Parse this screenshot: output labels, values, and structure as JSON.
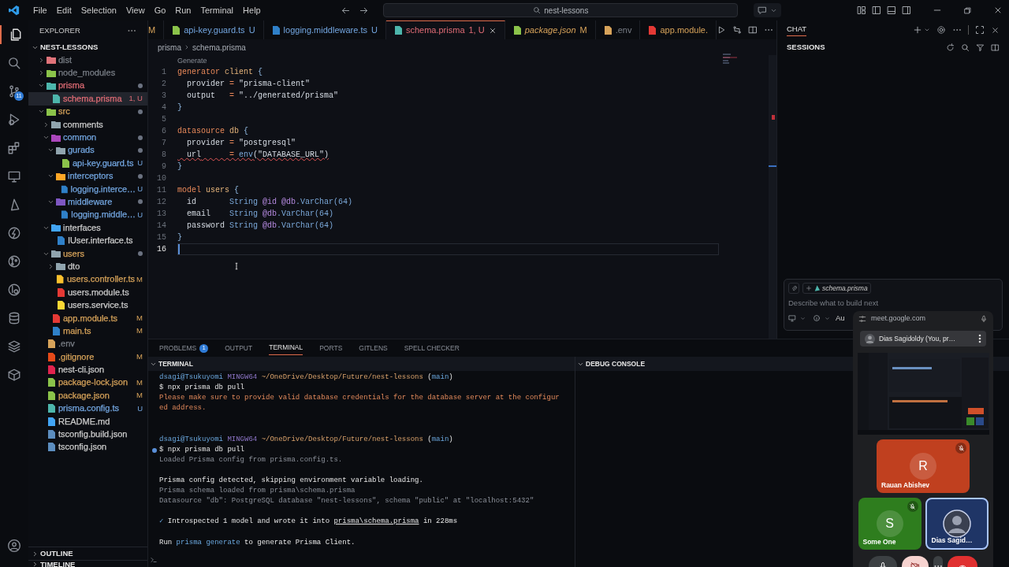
{
  "menu": [
    "File",
    "Edit",
    "Selection",
    "View",
    "Go",
    "Run",
    "Terminal",
    "Help"
  ],
  "search": "nest-lessons",
  "activity_bar": [
    {
      "kind": "files",
      "selected": true
    },
    {
      "kind": "search",
      "selected": false
    },
    {
      "kind": "branch",
      "selected": false,
      "badge": "11"
    },
    {
      "kind": "debug",
      "selected": false
    },
    {
      "kind": "blocks",
      "selected": false
    },
    {
      "kind": "monitor",
      "selected": false
    },
    {
      "kind": "triangle",
      "selected": false
    },
    {
      "kind": "bolt",
      "selected": false
    },
    {
      "kind": "commit",
      "selected": false
    },
    {
      "kind": "inspect",
      "selected": false
    },
    {
      "kind": "database",
      "selected": false
    },
    {
      "kind": "layers",
      "selected": false
    },
    {
      "kind": "box",
      "selected": false
    }
  ],
  "explorer": {
    "title": "EXPLORER",
    "project": "NEST-LESSONS",
    "tree": [
      {
        "name": "dist",
        "kind": "folder",
        "expanded": false,
        "color": "#7a7f87",
        "icon": {
          "color": "#e0737a"
        }
      },
      {
        "name": "node_modules",
        "kind": "folder",
        "expanded": false,
        "color": "#7a7f87",
        "icon": {
          "color": "#8bc34a"
        }
      },
      {
        "name": "prisma",
        "kind": "folder",
        "expanded": true,
        "color": "#e06c75",
        "icon": {
          "color": "#4db6ac"
        },
        "dot": true,
        "children": [
          {
            "name": "schema.prisma",
            "kind": "file",
            "color": "#e06c75",
            "icon": {
              "color": "#4db6ac"
            },
            "badge": "1, U",
            "selected": true
          }
        ]
      },
      {
        "name": "src",
        "kind": "folder",
        "expanded": true,
        "color": "#d7a35a",
        "icon": {
          "color": "#8bc34a"
        },
        "dot": true,
        "children": [
          {
            "name": "comments",
            "kind": "folder",
            "expanded": false,
            "icon": {
              "color": "#90a4ae"
            }
          },
          {
            "name": "common",
            "kind": "folder",
            "expanded": true,
            "color": "#73a6e0",
            "icon": {
              "color": "#ab47bc"
            },
            "dot": true,
            "children": [
              {
                "name": "gurads",
                "kind": "folder",
                "expanded": true,
                "color": "#73a6e0",
                "icon": {
                  "color": "#90a4ae"
                },
                "dot": true,
                "children": [
                  {
                    "name": "api-key.guard.ts",
                    "kind": "file",
                    "color": "#73a6e0",
                    "icon": {
                      "color": "#8bc34a"
                    },
                    "badge": "U",
                    "selected": false
                  }
                ]
              },
              {
                "name": "interceptors",
                "kind": "folder",
                "expanded": true,
                "color": "#73a6e0",
                "icon": {
                  "color": "#ffa726"
                },
                "dot": true,
                "children": [
                  {
                    "name": "logging.interce…",
                    "kind": "file",
                    "color": "#73a6e0",
                    "icon": {
                      "color": "#2f80c8"
                    },
                    "badge": "U",
                    "selected": false
                  }
                ]
              },
              {
                "name": "middleware",
                "kind": "folder",
                "expanded": true,
                "color": "#73a6e0",
                "icon": {
                  "color": "#7e57c2"
                },
                "dot": true,
                "children": [
                  {
                    "name": "logging.middle…",
                    "kind": "file",
                    "color": "#73a6e0",
                    "icon": {
                      "color": "#2f80c8"
                    },
                    "badge": "U",
                    "selected": false
                  }
                ]
              }
            ]
          },
          {
            "name": "interfaces",
            "kind": "folder",
            "expanded": true,
            "icon": {
              "color": "#42a5f5"
            },
            "children": [
              {
                "name": "IUser.interface.ts",
                "kind": "file",
                "icon": {
                  "color": "#2f80c8"
                },
                "selected": false
              }
            ]
          },
          {
            "name": "users",
            "kind": "folder",
            "expanded": true,
            "color": "#d7a35a",
            "icon": {
              "color": "#90a4ae"
            },
            "dot": true,
            "children": [
              {
                "name": "dto",
                "kind": "folder",
                "expanded": false,
                "icon": {
                  "color": "#90a4ae"
                }
              },
              {
                "name": "users.controller.ts",
                "kind": "file",
                "color": "#d7a35a",
                "icon": {
                  "color": "#fbc02d"
                },
                "badge": "M",
                "selected": false
              },
              {
                "name": "users.module.ts",
                "kind": "file",
                "icon": {
                  "color": "#e53935"
                },
                "selected": false
              },
              {
                "name": "users.service.ts",
                "kind": "file",
                "icon": {
                  "color": "#fdd835"
                },
                "selected": false
              }
            ]
          },
          {
            "name": "app.module.ts",
            "kind": "file",
            "color": "#d7a35a",
            "icon": {
              "color": "#e53935"
            },
            "badge": "M",
            "selected": false
          },
          {
            "name": "main.ts",
            "kind": "file",
            "color": "#d7a35a",
            "icon": {
              "color": "#2f80c8"
            },
            "badge": "M",
            "selected": false
          }
        ]
      },
      {
        "name": ".env",
        "kind": "file",
        "color": "#7a7f87",
        "icon": {
          "color": "#d7a35a"
        },
        "selected": false
      },
      {
        "name": ".gitignore",
        "kind": "file",
        "color": "#d7a35a",
        "icon": {
          "color": "#e64a19"
        },
        "badge": "M",
        "selected": false
      },
      {
        "name": "nest-cli.json",
        "kind": "file",
        "icon": {
          "color": "#e0234e"
        },
        "selected": false
      },
      {
        "name": "package-lock.json",
        "kind": "file",
        "color": "#d7a35a",
        "icon": {
          "color": "#8bc34a"
        },
        "badge": "M",
        "selected": false
      },
      {
        "name": "package.json",
        "kind": "file",
        "color": "#d7a35a",
        "icon": {
          "color": "#8bc34a"
        },
        "badge": "M",
        "selected": false
      },
      {
        "name": "prisma.config.ts",
        "kind": "file",
        "color": "#73a6e0",
        "icon": {
          "color": "#4db6ac"
        },
        "badge": "U",
        "selected": false
      },
      {
        "name": "README.md",
        "kind": "file",
        "icon": {
          "color": "#42a5f5"
        },
        "selected": false
      },
      {
        "name": "tsconfig.build.json",
        "kind": "file",
        "icon": {
          "color": "#5c8dbf"
        },
        "selected": false
      },
      {
        "name": "tsconfig.json",
        "kind": "file",
        "icon": {
          "color": "#5c8dbf"
        },
        "selected": false
      }
    ],
    "sections": [
      {
        "label": "OUTLINE",
        "expanded": false
      },
      {
        "label": "TIMELINE",
        "expanded": false
      }
    ]
  },
  "tabs": [
    {
      "badge": "M",
      "color": "#d7a35a",
      "selected": false
    },
    {
      "label": "api-key.guard.ts",
      "badge": "U",
      "color": "#73a6e0",
      "selected": false,
      "icon": {
        "color": "#8bc34a"
      }
    },
    {
      "label": "logging.middleware.ts",
      "badge": "U",
      "color": "#73a6e0",
      "selected": false,
      "icon": {
        "color": "#2f80c8"
      }
    },
    {
      "label": "schema.prisma",
      "badge": "1, U",
      "color": "#e06c75",
      "selected": true,
      "icon": {
        "color": "#4db6ac"
      }
    },
    {
      "label": "package.json",
      "badge": "M",
      "color": "#d7a35a",
      "selected": false,
      "preview": true,
      "icon": {
        "color": "#8bc34a"
      }
    },
    {
      "label": ".env",
      "color": "#7a7f87",
      "selected": false,
      "icon": {
        "color": "#d7a35a"
      }
    },
    {
      "label": "app.module.",
      "color": "#d7a35a",
      "selected": false,
      "icon": {
        "color": "#e53935"
      }
    }
  ],
  "breadcrumb": [
    "prisma",
    "schema.prisma"
  ],
  "codelens": "Generate",
  "code": [
    {
      "n": "1",
      "tokens": [
        {
          "kind": "kw",
          "t": "generator "
        },
        {
          "kind": "name",
          "t": "client "
        },
        {
          "kind": "punct",
          "t": "{"
        }
      ]
    },
    {
      "n": "2",
      "tokens": [
        {
          "kind": "key",
          "t": "  provider"
        },
        {
          "kind": "op",
          "t": " = "
        },
        {
          "kind": "str",
          "t": "\"prisma-client\""
        }
      ]
    },
    {
      "n": "3",
      "tokens": [
        {
          "kind": "key",
          "t": "  output"
        },
        {
          "kind": "op",
          "t": "   = "
        },
        {
          "kind": "str",
          "t": "\"../generated/prisma\""
        }
      ]
    },
    {
      "n": "4",
      "tokens": [
        {
          "kind": "punct",
          "t": "}"
        }
      ]
    },
    {
      "n": "5"
    },
    {
      "n": "6",
      "tokens": [
        {
          "kind": "kw",
          "t": "datasource "
        },
        {
          "kind": "name",
          "t": "db "
        },
        {
          "kind": "punct",
          "t": "{"
        }
      ]
    },
    {
      "n": "7",
      "tokens": [
        {
          "kind": "key",
          "t": "  provider"
        },
        {
          "kind": "op",
          "t": " = "
        },
        {
          "kind": "str",
          "t": "\"postgresql\""
        }
      ]
    },
    {
      "n": "8",
      "error": true,
      "tokens": [
        {
          "kind": "key",
          "t": "  url"
        },
        {
          "kind": "op",
          "t": "      = "
        },
        {
          "kind": "fn",
          "t": "env"
        },
        {
          "kind": "str",
          "t": "(\"DATABASE_URL\")"
        }
      ]
    },
    {
      "n": "9",
      "tokens": [
        {
          "kind": "punct",
          "t": "}"
        }
      ]
    },
    {
      "n": "10"
    },
    {
      "n": "11",
      "tokens": [
        {
          "kind": "kw",
          "t": "model "
        },
        {
          "kind": "name",
          "t": "users "
        },
        {
          "kind": "punct",
          "t": "{"
        }
      ]
    },
    {
      "n": "12",
      "tokens": [
        {
          "kind": "key",
          "t": "  id       "
        },
        {
          "kind": "type",
          "t": "String "
        },
        {
          "kind": "attr",
          "t": "@id @db"
        },
        {
          "kind": "type",
          "t": ".VarChar(64)"
        }
      ]
    },
    {
      "n": "13",
      "tokens": [
        {
          "kind": "key",
          "t": "  email    "
        },
        {
          "kind": "type",
          "t": "String "
        },
        {
          "kind": "attr",
          "t": "@db"
        },
        {
          "kind": "type",
          "t": ".VarChar(64)"
        }
      ]
    },
    {
      "n": "14",
      "tokens": [
        {
          "kind": "key",
          "t": "  password "
        },
        {
          "kind": "type",
          "t": "String "
        },
        {
          "kind": "attr",
          "t": "@db"
        },
        {
          "kind": "type",
          "t": ".VarChar(64)"
        }
      ]
    },
    {
      "n": "15",
      "tokens": [
        {
          "kind": "punct",
          "t": "}"
        }
      ]
    },
    {
      "n": "16",
      "current": true
    }
  ],
  "chat": {
    "tab": "CHAT",
    "sessions": "SESSIONS",
    "attachment": "schema.prisma",
    "placeholder": "Describe what to build next",
    "mode": "Au"
  },
  "panel_tabs": [
    {
      "label": "PROBLEMS",
      "badge": "1",
      "selected": false
    },
    {
      "label": "OUTPUT",
      "selected": false
    },
    {
      "label": "TERMINAL",
      "selected": true
    },
    {
      "label": "PORTS",
      "selected": false
    },
    {
      "label": "GITLENS",
      "selected": false
    },
    {
      "label": "SPELL CHECKER",
      "selected": false
    }
  ],
  "terminal": {
    "title": "TERMINAL",
    "blocks": [
      {
        "kind": "prompt",
        "lines": [
          {
            "segments": [
              {
                "kind": "user",
                "t": "dsagi@Tsukuyomi "
              },
              {
                "kind": "host",
                "t": "MINGW64 "
              },
              {
                "kind": "path",
                "t": "~/OneDrive/Desktop/Future/nest-lessons "
              },
              {
                "kind": "plain",
                "t": "("
              },
              {
                "kind": "user",
                "t": "main"
              },
              {
                "kind": "plain",
                "t": ")"
              }
            ]
          },
          {
            "segments": [
              {
                "kind": "plain",
                "t": "$ npx prisma db pull"
              }
            ]
          },
          {
            "segments": [
              {
                "kind": "warn",
                "t": "Please make sure to provide valid database credentials for the database server at the configured address."
              }
            ]
          }
        ]
      },
      {
        "kind": "prompt",
        "lines": [
          {
            "segments": [
              {
                "kind": "user",
                "t": "dsagi@Tsukuyomi "
              },
              {
                "kind": "host",
                "t": "MINGW64 "
              },
              {
                "kind": "path",
                "t": "~/OneDrive/Desktop/Future/nest-lessons "
              },
              {
                "kind": "plain",
                "t": "("
              },
              {
                "kind": "user",
                "t": "main"
              },
              {
                "kind": "plain",
                "t": ")"
              }
            ]
          },
          {
            "decoration": true,
            "segments": [
              {
                "kind": "plain",
                "t": "$ npx prisma db pull"
              }
            ]
          },
          {
            "segments": [
              {
                "kind": "dim",
                "t": "Loaded Prisma config from prisma.config.ts."
              }
            ]
          }
        ]
      },
      {
        "kind": "output",
        "lines": [
          {
            "segments": [
              {
                "kind": "plain",
                "t": "Prisma config detected, skipping environment variable loading."
              }
            ]
          },
          {
            "segments": [
              {
                "kind": "dim",
                "t": "Prisma schema loaded from prisma\\schema.prisma"
              }
            ]
          },
          {
            "segments": [
              {
                "kind": "dim",
                "t": "Datasource \"db\": PostgreSQL database \"nest-lessons\", schema \"public\" at \"localhost:5432\""
              }
            ]
          }
        ]
      },
      {
        "kind": "output",
        "lines": [
          {
            "segments": [
              {
                "kind": "ok",
                "t": "✓"
              },
              {
                "kind": "plain",
                "t": " Introspected 1 model and wrote it into "
              },
              {
                "kind": "link",
                "t": "prisma\\schema.prisma"
              },
              {
                "kind": "plain",
                "t": " in 228ms"
              }
            ]
          }
        ]
      },
      {
        "kind": "output",
        "lines": [
          {
            "segments": [
              {
                "kind": "plain",
                "t": "Run "
              },
              {
                "kind": "user",
                "t": "prisma generate"
              },
              {
                "kind": "plain",
                "t": " to generate Prisma Client."
              }
            ]
          }
        ]
      }
    ]
  },
  "debug_console": "DEBUG CONSOLE",
  "meet": {
    "url": "meet.google.com",
    "presenter": "Dias Sagidoldy (You, pr…",
    "participants": [
      {
        "name": "Rauan Abishev",
        "initial": "R",
        "kind": "initial",
        "color": "#c0401f",
        "muted": true,
        "selected": false
      },
      {
        "name": "Some One",
        "initial": "S",
        "kind": "initial",
        "color": "#2e7d1e",
        "muted": true,
        "selected": false
      },
      {
        "name": "Dias Sagid…",
        "kind": "avatar",
        "color": "#1f3566",
        "muted": false,
        "selected": true
      }
    ],
    "controls": [
      {
        "kind": "mic"
      },
      {
        "kind": "camera_off"
      },
      {
        "kind": "more"
      },
      {
        "kind": "hangup"
      }
    ]
  }
}
